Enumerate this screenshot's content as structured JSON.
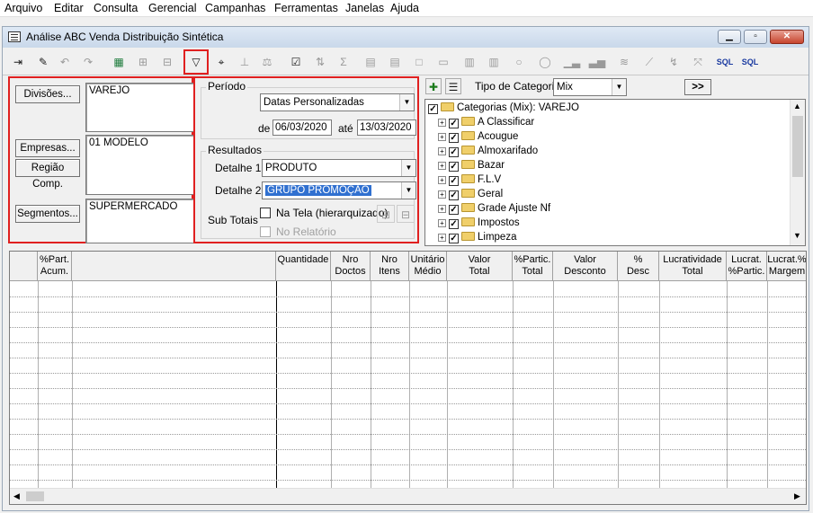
{
  "menu": [
    "Arquivo",
    "Editar",
    "Consulta",
    "Gerencial",
    "Campanhas",
    "Ferramentas",
    "Janelas",
    "Ajuda"
  ],
  "window": {
    "title": "Análise ABC Venda Distribuição Sintética",
    "min": "▁",
    "restore": "▫",
    "close": "✕"
  },
  "toolbar": {
    "sql1": "SQL",
    "sql2": "SQL"
  },
  "left": {
    "divisoes_label": "Divisões...",
    "divisoes_value": "VAREJO",
    "empresas_label": "Empresas...",
    "regiao_label": "Região Comp.",
    "empresas_value": "01 MODELO",
    "segmentos_label": "Segmentos...",
    "segmentos_value": "SUPERMERCADO"
  },
  "periodo": {
    "label": "Período",
    "tipo": "Datas Personalizadas",
    "de_label": "de",
    "de_value": "06/03/2020",
    "ate_label": "até",
    "ate_value": "13/03/2020"
  },
  "resultados": {
    "label": "Resultados",
    "detalhe1_label": "Detalhe 1",
    "detalhe1_value": "PRODUTO",
    "detalhe2_label": "Detalhe 2",
    "detalhe2_value": "GRUPO PROMOÇÃO",
    "subtotais_label": "Sub Totais",
    "na_tela_label": "Na Tela (hierarquizado)",
    "no_relatorio_label": "No Relatório"
  },
  "categoria": {
    "tipo_label": "Tipo de Categoria",
    "tipo_value": "Mix",
    "more_button": ">>",
    "root": "Categorias (Mix): VAREJO",
    "items": [
      "A Classificar",
      "Acougue",
      "Almoxarifado",
      "Bazar",
      "F.L.V",
      "Geral",
      "Grade Ajuste Nf",
      "Impostos",
      "Limpeza"
    ]
  },
  "grid": {
    "columns": [
      {
        "l1": "%Part.",
        "l2": "Acum."
      },
      {
        "l1": "",
        "l2": ""
      },
      {
        "l1": "Quantidade",
        "l2": ""
      },
      {
        "l1": "Nro",
        "l2": "Doctos"
      },
      {
        "l1": "Nro",
        "l2": "Itens"
      },
      {
        "l1": "Unitário",
        "l2": "Médio"
      },
      {
        "l1": "Valor",
        "l2": "Total"
      },
      {
        "l1": "%Partic.",
        "l2": "Total"
      },
      {
        "l1": "Valor",
        "l2": "Desconto"
      },
      {
        "l1": "%",
        "l2": "Desc"
      },
      {
        "l1": "Lucratividade",
        "l2": "Total"
      },
      {
        "l1": "Lucrat.",
        "l2": "%Partic."
      },
      {
        "l1": "Lucrat.%",
        "l2": "Margem"
      }
    ]
  }
}
